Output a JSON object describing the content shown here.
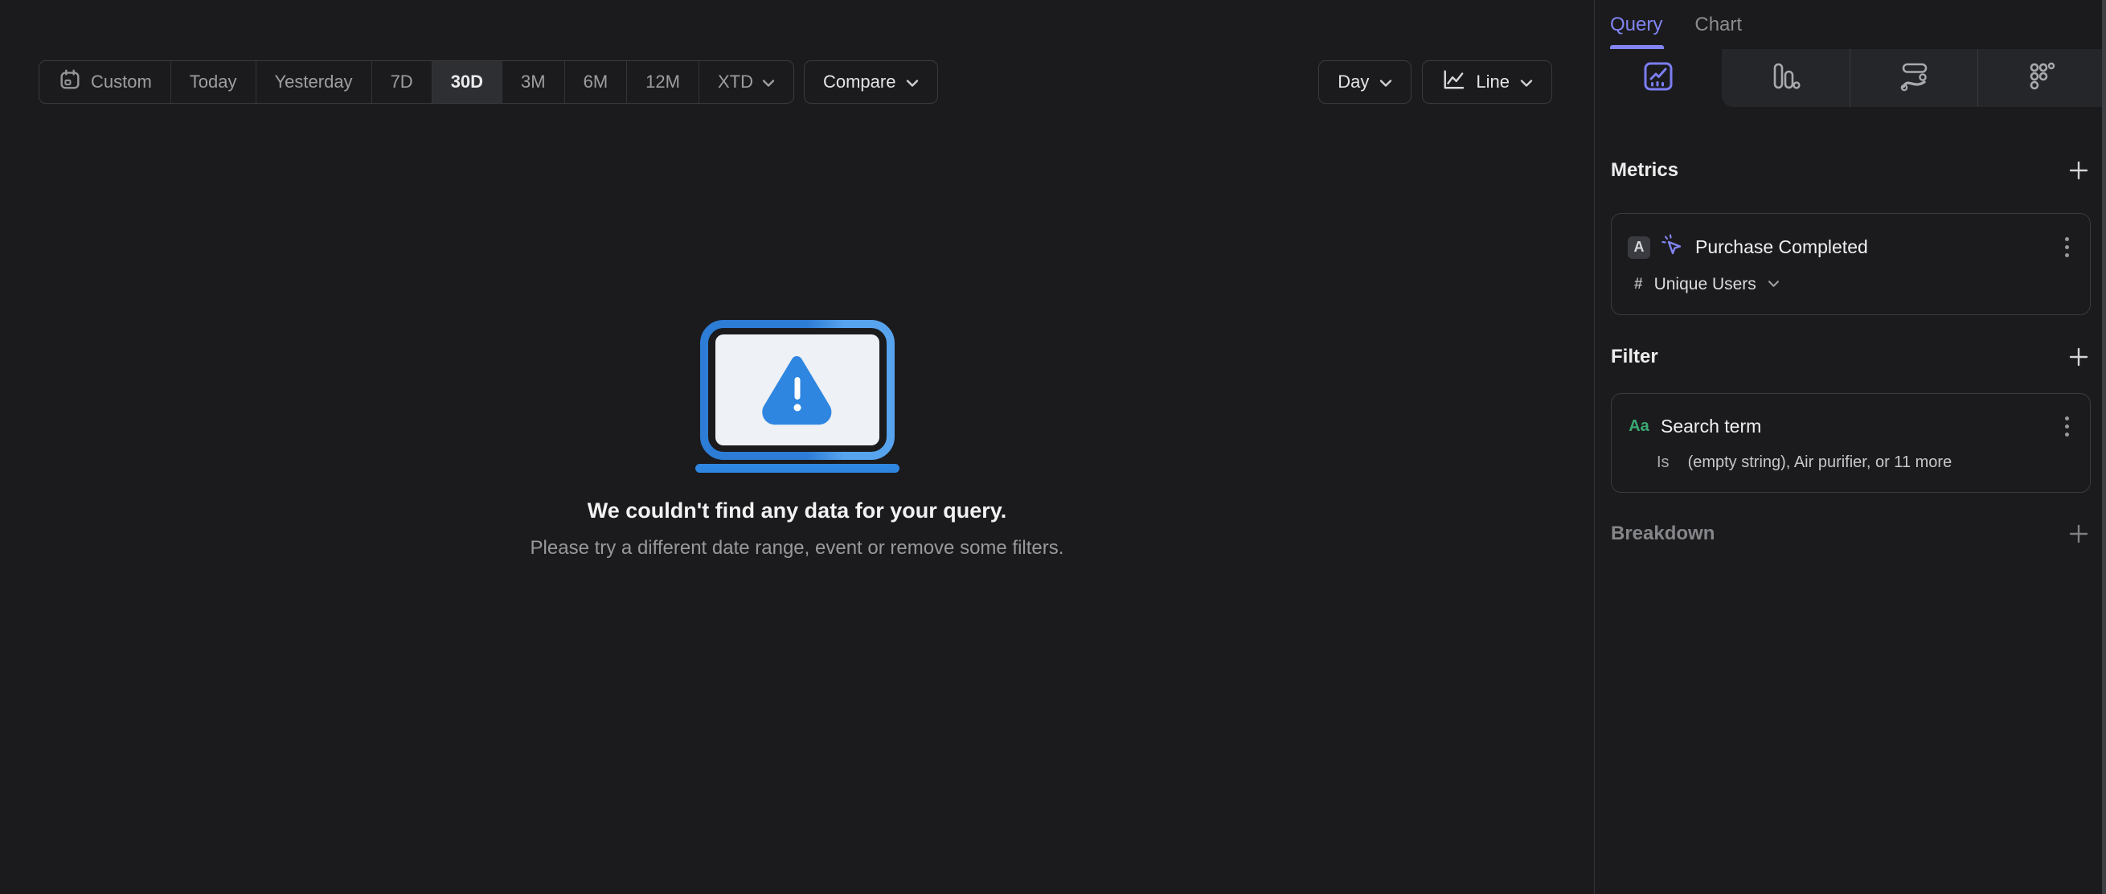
{
  "toolbar": {
    "ranges": [
      {
        "label": "Custom"
      },
      {
        "label": "Today"
      },
      {
        "label": "Yesterday"
      },
      {
        "label": "7D"
      },
      {
        "label": "30D",
        "selected": true
      },
      {
        "label": "3M"
      },
      {
        "label": "6M"
      },
      {
        "label": "12M"
      },
      {
        "label": "XTD"
      }
    ],
    "compare_label": "Compare",
    "granularity_label": "Day",
    "chart_type_label": "Line"
  },
  "empty_state": {
    "title": "We couldn't find any data for your query.",
    "subtitle": "Please try a different date range, event or remove some filters."
  },
  "sidebar": {
    "tabs": [
      {
        "label": "Query",
        "active": true
      },
      {
        "label": "Chart",
        "active": false
      }
    ],
    "view_tabs": [
      "insights",
      "funnels",
      "flows",
      "retention"
    ],
    "metrics": {
      "heading": "Metrics",
      "items": [
        {
          "letter": "A",
          "name": "Purchase Completed",
          "aggregation_prefix": "#",
          "aggregation": "Unique Users"
        }
      ]
    },
    "filter": {
      "heading": "Filter",
      "items": [
        {
          "type_badge": "Aa",
          "property": "Search term",
          "operator": "Is",
          "value": "(empty string), Air purifier, or 11 more"
        }
      ]
    },
    "breakdown": {
      "heading": "Breakdown"
    }
  },
  "colors": {
    "accent_purple": "#8184f2",
    "laptop_blue_dark": "#2d7cd6",
    "laptop_blue_light": "#57a3ee",
    "warning_blue": "#2e86e0",
    "filter_green": "#3ba873",
    "selected_segment_bg": "#2e2f33"
  }
}
